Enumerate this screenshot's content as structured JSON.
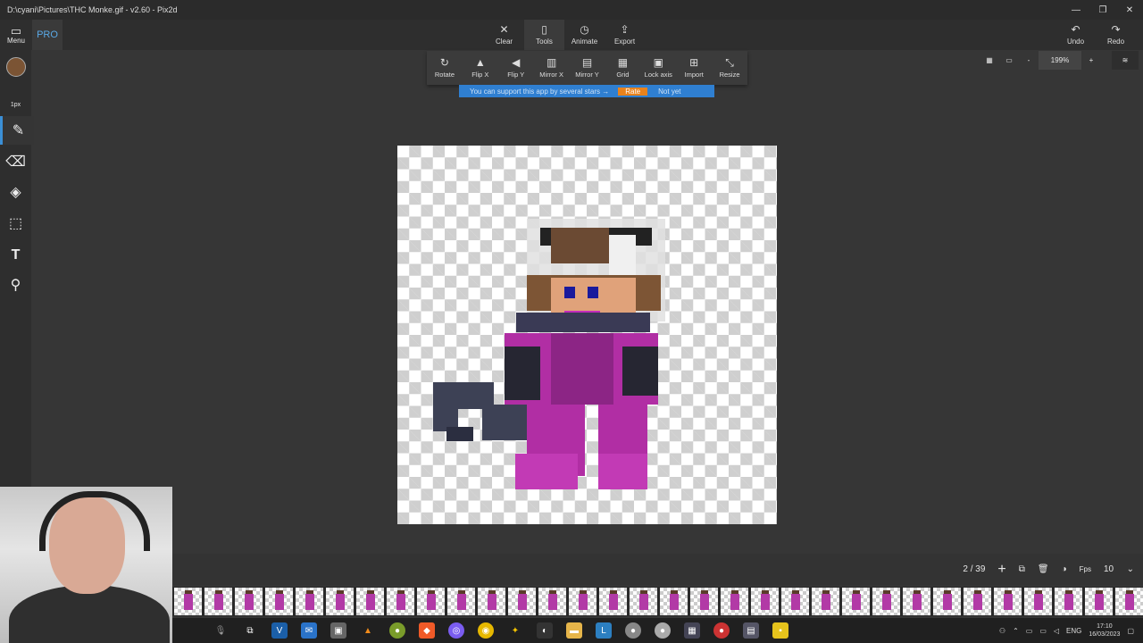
{
  "window": {
    "title": "D:\\cyani\\Pictures\\THC Monke.gif - v2.60 - Pix2d",
    "minimize": "—",
    "maximize": "❐",
    "close": "✕"
  },
  "topbar": {
    "menu_label": "Menu",
    "pro_label": "PRO",
    "center": [
      {
        "label": "Clear",
        "icon": "✕"
      },
      {
        "label": "Tools",
        "icon": "▯"
      },
      {
        "label": "Animate",
        "icon": "◷"
      },
      {
        "label": "Export",
        "icon": "⇪"
      }
    ],
    "undo_label": "Undo",
    "redo_label": "Redo"
  },
  "tools_menu": [
    {
      "label": "Rotate",
      "icon": "↻"
    },
    {
      "label": "Flip X",
      "icon": "▲"
    },
    {
      "label": "Flip Y",
      "icon": "◀"
    },
    {
      "label": "Mirror X",
      "icon": "▥"
    },
    {
      "label": "Mirror Y",
      "icon": "▤"
    },
    {
      "label": "Grid",
      "icon": "▦"
    },
    {
      "label": "Lock axis",
      "icon": "🔒"
    },
    {
      "label": "Import",
      "icon": "⊞"
    },
    {
      "label": "Resize",
      "icon": "⤡"
    }
  ],
  "banner": {
    "text": "You can support this app by several stars →",
    "rate": "Rate",
    "not_yet": "Not yet"
  },
  "zoom": {
    "value": "199%",
    "minus": "-",
    "plus": "+"
  },
  "left": {
    "brush_size": "1px",
    "color": "#7b5434"
  },
  "frames": {
    "position": "2 / 39",
    "fps_label": "Fps",
    "fps_value": "10",
    "count": 39
  },
  "tray": {
    "lang": "ENG",
    "time": "17:10",
    "date": "16/03/2023"
  }
}
